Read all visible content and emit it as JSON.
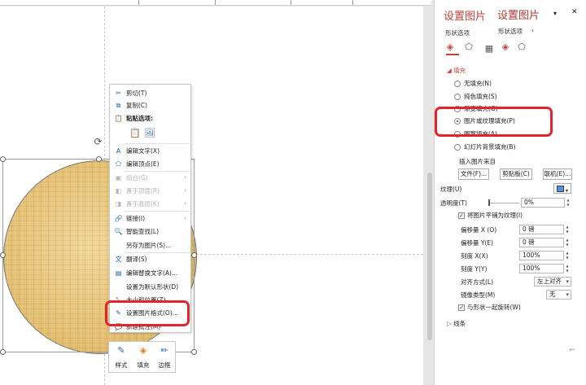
{
  "context_menu": {
    "cut": "剪切(T)",
    "copy": "复制(C)",
    "paste_options": "粘贴选项:",
    "edit_text": "编辑文字(X)",
    "edit_points": "编辑顶点(E)",
    "group": "组合(G)",
    "bring_front": "置于顶层(R)",
    "send_back": "置于底层(K)",
    "link": "链接(I)",
    "smart_lookup": "智能查找(L)",
    "save_as_picture": "另存为图片(S)...",
    "translate": "翻译(S)",
    "edit_alt_text": "编辑替换文字(A)...",
    "set_default_shape": "设置为默认形状(D)",
    "size_position": "大小和位置(Z)...",
    "format_picture": "设置图片格式(O)...",
    "new_comment": "新建批注(M)"
  },
  "mini_toolbar": {
    "style": "样式",
    "fill": "填充",
    "border": "边框"
  },
  "panel": {
    "title": "设置图片",
    "title_overlay": "设置图片",
    "tab_shape_options": "形状选项",
    "tab_shape_options_overlay": "形状选项",
    "fill_section": "填充",
    "no_fill": "无填充(N)",
    "solid_fill": "纯色填充(S)",
    "gradient_fill": "渐变填充(G)",
    "picture_texture_fill": "图片或纹理填充(P)",
    "pattern_fill": "图案填充(A)",
    "slide_bg_fill": "幻灯片背景填充(B)",
    "insert_from": "插入图片来自",
    "file_btn": "文件(F)...",
    "clipboard_btn": "剪贴板(C)",
    "online_btn": "联机(E)...",
    "texture_label": "纹理(U)",
    "transparency_label": "透明度(T)",
    "transparency_value": "0%",
    "tile_label": "将图片平铺为纹理(I)",
    "offset_x_label": "偏移量 X (O)",
    "offset_x_value": "0 磅",
    "offset_y_label": "偏移量 Y(E)",
    "offset_y_value": "0 磅",
    "scale_x_label": "刻度 X(X)",
    "scale_x_value": "100%",
    "scale_y_label": "刻度 Y(Y)",
    "scale_y_value": "100%",
    "align_label": "对齐方式(L)",
    "align_value": "左上对齐",
    "mirror_label": "镜像类型(M)",
    "mirror_value": "无",
    "rotate_label": "与形状一起旋转(W)",
    "line_section": "线条"
  },
  "colors": {
    "accent": "#c2423a",
    "highlight": "#e5232b",
    "texture_fill": "#e2bd6e"
  }
}
